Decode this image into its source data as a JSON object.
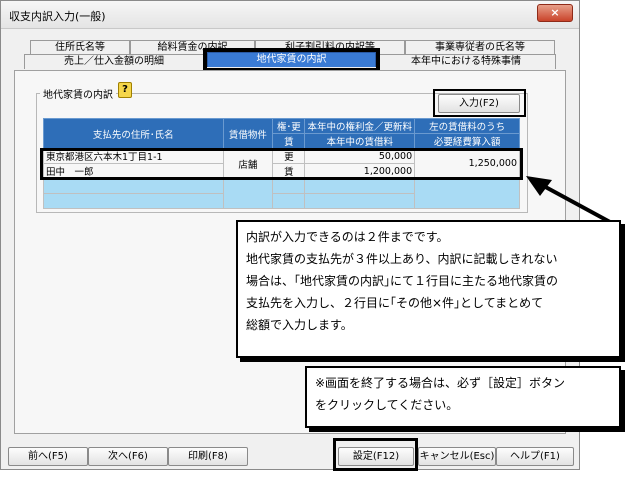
{
  "window": {
    "title": "収支内訳入力(一般)",
    "close_label": "×"
  },
  "tabs": {
    "row1": [
      "住所氏名等",
      "給料賃金の内訳",
      "利子割引料の内訳等",
      "事業専従者の氏名等"
    ],
    "row2": [
      "売上／仕入金額の明細",
      "地代家賃の内訳",
      "本年中における特殊事情"
    ]
  },
  "group": {
    "label": "地代家賃の内訳",
    "help_icon": "?"
  },
  "input_button": "入力(F2)",
  "table": {
    "headers": {
      "address": "支払先の住所･氏名",
      "property": "賃借物件",
      "renew_top": "権･更",
      "renew_bottom": "賃",
      "amount_top": "本年中の権利金／更新料",
      "amount_bottom": "本年中の賃借料",
      "necessary_top": "左の賃借料のうち",
      "necessary_bottom": "必要経費算入額"
    },
    "rows": [
      {
        "address": "東京都港区六本木1丁目1-1",
        "name": "田中　一郎",
        "property": "店舗",
        "kind_top": "更",
        "kind_bottom": "賃",
        "amount_top": "50,000",
        "amount_bottom": "1,200,000",
        "necessary": "1,250,000"
      }
    ]
  },
  "callout_main": {
    "lines": [
      "内訳が入力できるのは２件までです。",
      "地代家賃の支払先が３件以上あり、内訳に記載しきれない",
      "場合は、｢地代家賃の内訳｣にて１行目に主たる地代家賃の",
      "支払先を入力し、２行目に｢その他×件｣としてまとめて",
      "総額で入力します。"
    ]
  },
  "callout_note": {
    "lines": [
      "※画面を終了する場合は、必ず［設定］ボタン",
      "をクリックしてください。"
    ]
  },
  "bottom_buttons": {
    "prev": "前へ(F5)",
    "next": "次へ(F6)",
    "print": "印刷(F8)",
    "settings": "設定(F12)",
    "cancel": "キャンセル(Esc)",
    "help": "ヘルプ(F1)"
  }
}
